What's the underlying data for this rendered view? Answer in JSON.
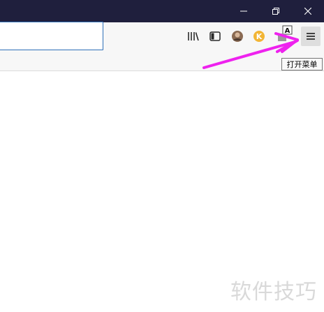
{
  "window": {
    "minimize_icon": "minimize-icon",
    "restore_icon": "restore-icon",
    "close_icon": "close-icon",
    "titlebar_color": "#1f1f3d"
  },
  "toolbar": {
    "url_value": "",
    "icons": [
      "library-icon",
      "sidebar-icon",
      "avatar-icon",
      "extension-icon",
      "translate-icon",
      "hamburger-menu-icon"
    ]
  },
  "tooltip": {
    "text": "打开菜单"
  },
  "annotation": {
    "arrow_color": "#ee22ee"
  },
  "watermark": {
    "text": "软件技巧"
  }
}
